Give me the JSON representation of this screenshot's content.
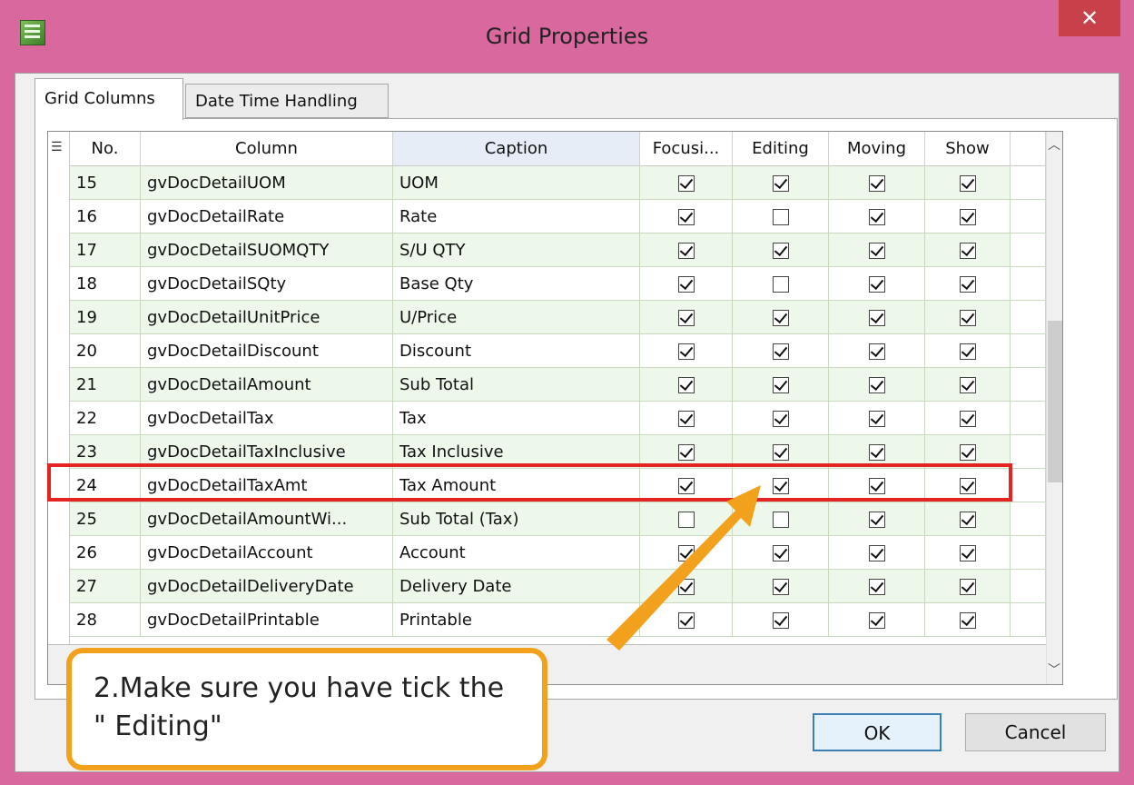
{
  "window": {
    "title": "Grid Properties",
    "close_label": "✕"
  },
  "tabs": [
    {
      "label": "Grid Columns"
    },
    {
      "label": "Date Time Handling"
    }
  ],
  "grid": {
    "headers": {
      "no": "No.",
      "column": "Column",
      "caption": "Caption",
      "focusing": "Focusi...",
      "editing": "Editing",
      "moving": "Moving",
      "show": "Show"
    },
    "rows": [
      {
        "no": "15",
        "column": "gvDocDetailUOM",
        "caption": "UOM",
        "focusing": true,
        "editing": true,
        "moving": true,
        "show": true
      },
      {
        "no": "16",
        "column": "gvDocDetailRate",
        "caption": "Rate",
        "focusing": true,
        "editing": false,
        "moving": true,
        "show": true
      },
      {
        "no": "17",
        "column": "gvDocDetailSUOMQTY",
        "caption": "S/U QTY",
        "focusing": true,
        "editing": true,
        "moving": true,
        "show": true
      },
      {
        "no": "18",
        "column": "gvDocDetailSQty",
        "caption": "Base Qty",
        "focusing": true,
        "editing": false,
        "moving": true,
        "show": true
      },
      {
        "no": "19",
        "column": "gvDocDetailUnitPrice",
        "caption": "U/Price",
        "focusing": true,
        "editing": true,
        "moving": true,
        "show": true
      },
      {
        "no": "20",
        "column": "gvDocDetailDiscount",
        "caption": "Discount",
        "focusing": true,
        "editing": true,
        "moving": true,
        "show": true
      },
      {
        "no": "21",
        "column": "gvDocDetailAmount",
        "caption": "Sub Total",
        "focusing": true,
        "editing": true,
        "moving": true,
        "show": true
      },
      {
        "no": "22",
        "column": "gvDocDetailTax",
        "caption": "Tax",
        "focusing": true,
        "editing": true,
        "moving": true,
        "show": true
      },
      {
        "no": "23",
        "column": "gvDocDetailTaxInclusive",
        "caption": "Tax Inclusive",
        "focusing": true,
        "editing": true,
        "moving": true,
        "show": true
      },
      {
        "no": "24",
        "column": "gvDocDetailTaxAmt",
        "caption": "Tax Amount",
        "focusing": true,
        "editing": true,
        "moving": true,
        "show": true
      },
      {
        "no": "25",
        "column": "gvDocDetailAmountWi...",
        "caption": "Sub Total (Tax)",
        "focusing": false,
        "editing": false,
        "moving": true,
        "show": true
      },
      {
        "no": "26",
        "column": "gvDocDetailAccount",
        "caption": "Account",
        "focusing": true,
        "editing": true,
        "moving": true,
        "show": true
      },
      {
        "no": "27",
        "column": "gvDocDetailDeliveryDate",
        "caption": "Delivery Date",
        "focusing": true,
        "editing": true,
        "moving": true,
        "show": true
      },
      {
        "no": "28",
        "column": "gvDocDetailPrintable",
        "caption": "Printable",
        "focusing": true,
        "editing": true,
        "moving": true,
        "show": true
      }
    ]
  },
  "buttons": {
    "ok": "OK",
    "cancel": "Cancel"
  },
  "callout": {
    "line1": "2.Make sure you have tick the",
    "line2": "\" Editing\""
  },
  "colors": {
    "title_bar": "#d9689e",
    "close": "#c7404a",
    "highlight": "#e42323",
    "callout_border": "#f2a11d",
    "row_alt": "#eef8ea"
  }
}
